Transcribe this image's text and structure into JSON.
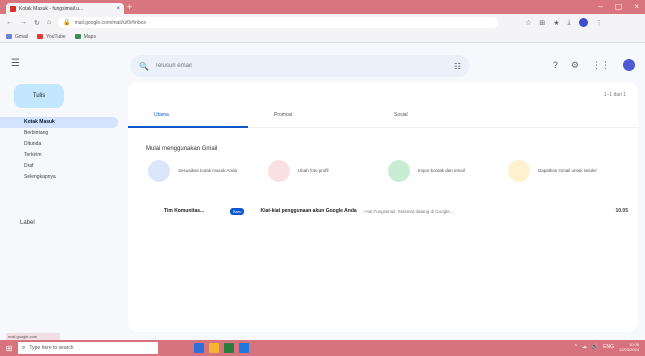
{
  "browser": {
    "tab_title": "Kotak Masuk - fungsimail.u...",
    "tab_close": "×",
    "new_tab": "+",
    "window_controls": [
      "–",
      "▢",
      "×"
    ],
    "url": "mail.google.com/mail/u/0/#inbox",
    "nav": [
      "←",
      "→",
      "↻",
      "⌂"
    ],
    "toolbar_icons": [
      "☆",
      "⊞",
      "★",
      "⤓",
      "⋮"
    ],
    "bookmarks": [
      {
        "label": "Gmail",
        "color": "#6b7ee0"
      },
      {
        "label": "YouTube",
        "color": "#e53935"
      },
      {
        "label": "Maps",
        "color": "#3c8d57"
      }
    ]
  },
  "header": {
    "menu_icon": "☰",
    "search_placeholder": "Telusuri email",
    "search_icon": "🔍",
    "filter_icon": "☷",
    "icons": [
      "?",
      "⚙",
      "⋮⋮"
    ]
  },
  "sidebar": {
    "compose_label": "Tulis",
    "items": [
      {
        "label": "Kotak Masuk",
        "active": true
      },
      {
        "label": "Berbintang",
        "active": false
      },
      {
        "label": "Ditunda",
        "active": false
      },
      {
        "label": "Terkirim",
        "active": false
      },
      {
        "label": "Draf",
        "active": false
      },
      {
        "label": "Selengkapnya",
        "active": false
      }
    ],
    "labels_heading": "Label"
  },
  "main": {
    "pager": "1–1 dari 1",
    "tabs": [
      {
        "label": "Utama",
        "active": true
      },
      {
        "label": "Promosi",
        "active": false
      },
      {
        "label": "Sosial",
        "active": false
      }
    ],
    "start_title": "Mulai menggunakan Gmail",
    "cards": [
      {
        "text": "Sesuaikan kotak masuk Anda",
        "color": "#dbe6fb"
      },
      {
        "text": "Ubah foto profil",
        "color": "#fbe0e2"
      },
      {
        "text": "Impor kontak dan email",
        "color": "#c9ecd4"
      },
      {
        "text": "Dapatkan Gmail untuk seluler",
        "color": "#fdf1cf"
      }
    ],
    "email": {
      "sender": "Tim Komunitas...",
      "badge": "Baru",
      "subject": "Kiat-kiat penggunaan akun Google Anda",
      "snippet": " - Hai Fungsimail, Selamat datang di Google...",
      "time": "10.05"
    }
  },
  "statusbar": "mail.google.com",
  "taskbar": {
    "start_icon": "⊞",
    "search_placeholder": "Type here to search",
    "apps": [
      "#2f6fd6",
      "#f2b632",
      "#2a7d3b",
      "#1f7ae0"
    ],
    "tray": [
      "^",
      "☁",
      "🔊",
      "ENG"
    ],
    "time": "10.05",
    "date": "12/03/2024"
  }
}
